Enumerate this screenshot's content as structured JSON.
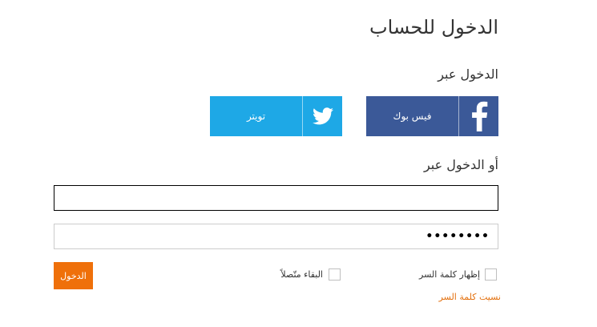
{
  "page": {
    "title": "الدخول للحساب",
    "via_label": "الدخول عبر",
    "or_via_label": "أو الدخول عبر"
  },
  "social": {
    "facebook": {
      "label": "فيس بوك",
      "icon": "facebook-icon",
      "color": "#3b5998"
    },
    "twitter": {
      "label": "تويتر",
      "icon": "twitter-icon",
      "color": "#1ea8e6"
    }
  },
  "form": {
    "username_value": "",
    "password_value": "••••••••",
    "show_password_label": "إظهار كلمة السر",
    "stay_connected_label": "البقاء متّصلاً",
    "login_label": "الدخول",
    "forgot_label": "نسيت كلمة السر"
  },
  "colors": {
    "accent": "#ef700a",
    "link": "#e3700e"
  }
}
